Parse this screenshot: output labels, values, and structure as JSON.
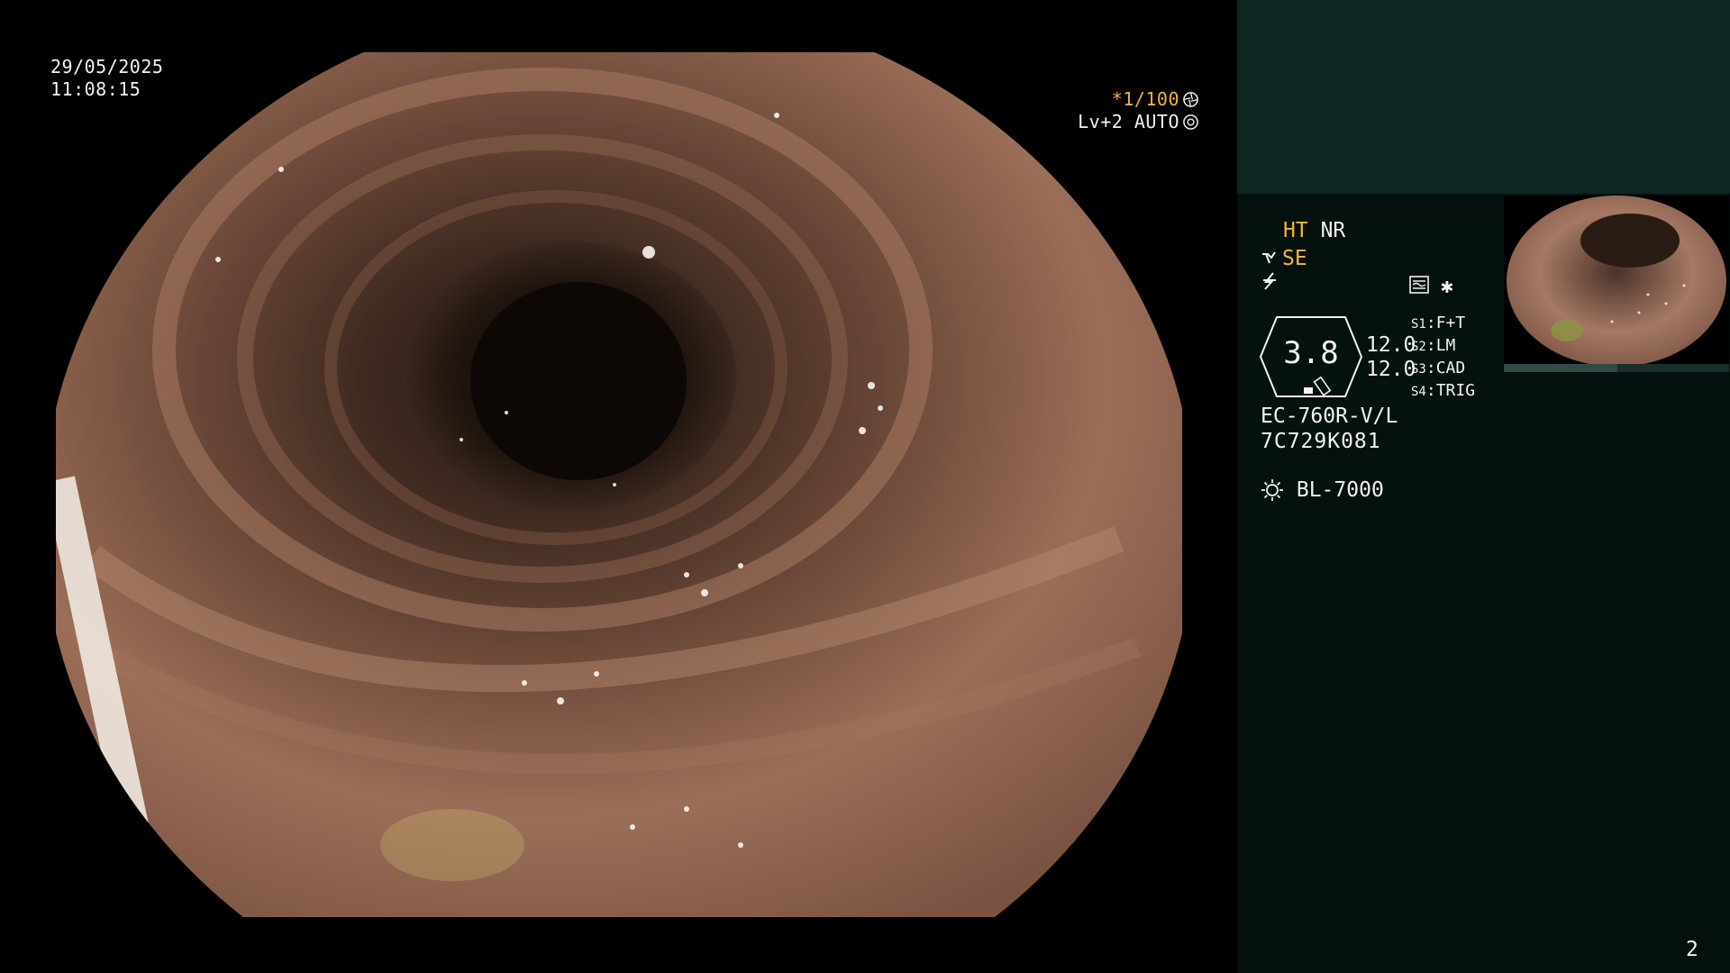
{
  "overlay": {
    "date": "29/05/2025",
    "time": "11:08:15",
    "shutter": "*1/100",
    "gain": "Lv+2 AUTO"
  },
  "panel": {
    "ht": "HT",
    "nr": "NR",
    "se": "SE",
    "gauge_value": "3.8",
    "gauge_sub1": "12.0",
    "gauge_sub2": "12.0",
    "slots": [
      {
        "key": "S1",
        "value": "F+T"
      },
      {
        "key": "S2",
        "value": "LM"
      },
      {
        "key": "S3",
        "value": "CAD"
      },
      {
        "key": "S4",
        "value": "TRIG"
      }
    ],
    "scope_model": "EC-760R-V/L",
    "serial": "7C729K081",
    "light_source": "BL-7000",
    "page_number": "2"
  },
  "icons": {
    "shutter": "aperture-icon",
    "gain": "iris-icon",
    "se": "scope-icon",
    "flash": "lightning-icon",
    "grid": "enhancement-icon",
    "star": "asterisk-icon",
    "light": "sun-icon"
  },
  "colors": {
    "accent": "#f0b63a",
    "panel_bg": "#05110f",
    "panel_top": "#0f2623"
  }
}
